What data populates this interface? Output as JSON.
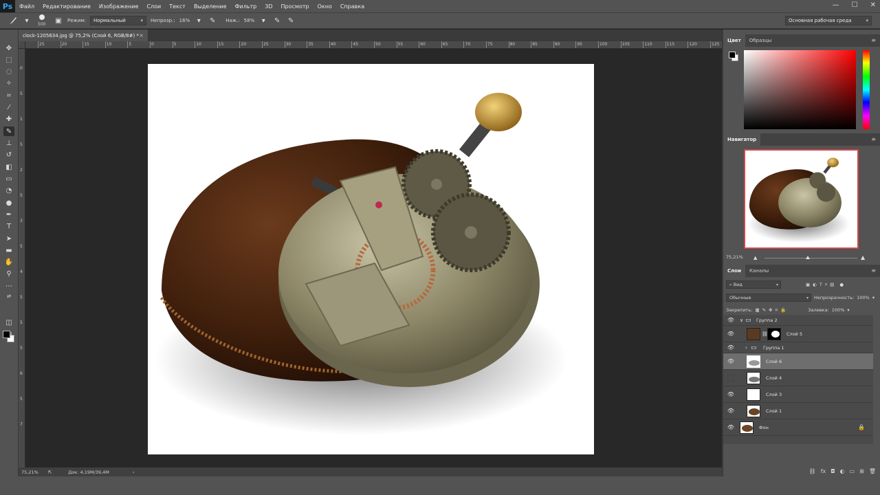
{
  "app": {
    "logo": "Ps"
  },
  "menu": [
    "Файл",
    "Редактирование",
    "Изображение",
    "Слои",
    "Текст",
    "Выделение",
    "Фильтр",
    "3D",
    "Просмотр",
    "Окно",
    "Справка"
  ],
  "window_controls": {
    "minimize": "—",
    "maximize": "☐",
    "close": "✕"
  },
  "options": {
    "brush_size": "500",
    "mode_label": "Режим:",
    "mode_value": "Нормальный",
    "opacity_label": "Непрозр.:",
    "opacity_value": "16%",
    "flow_label": "Наж.:",
    "flow_value": "58%",
    "workspace": "Основная рабочая среда"
  },
  "document": {
    "tab_title": "clock-1205634.jpg @ 75,2% (Слой 6, RGB/8#) *",
    "close": "×"
  },
  "rulers": {
    "top_labels": [
      "25",
      "20",
      "15",
      "10",
      "5",
      "0",
      "5",
      "10",
      "15",
      "20",
      "25",
      "30",
      "35",
      "40",
      "45",
      "50",
      "55",
      "60",
      "65",
      "70",
      "75",
      "80",
      "85",
      "90",
      "95",
      "100",
      "105",
      "110",
      "115",
      "120",
      "125"
    ],
    "left_labels": [
      "0",
      "5",
      "1",
      "5",
      "2",
      "5",
      "3",
      "5",
      "4",
      "5",
      "5",
      "5",
      "6",
      "5",
      "7"
    ]
  },
  "status": {
    "zoom": "75,21%",
    "doc_size": "Док: 4,19M/39,4M"
  },
  "color_panel": {
    "tabs": [
      "Цвет",
      "Образцы"
    ],
    "foreground": "#000000",
    "background": "#ffffff"
  },
  "navigator": {
    "tab": "Навигатор",
    "zoom": "75,21%"
  },
  "layers_panel": {
    "tabs": [
      "Слои",
      "Каналы"
    ],
    "filter": "Вид",
    "blend_mode": "Обычные",
    "opacity_label": "Непрозрачность:",
    "opacity_value": "100%",
    "lock_label": "Закрепить:",
    "fill_label": "Заливка:",
    "fill_value": "100%",
    "layers": [
      {
        "name": "Группа 2",
        "type": "group",
        "visible": true
      },
      {
        "name": "Слой 5",
        "type": "layer-mask",
        "visible": true
      },
      {
        "name": "Группа 1",
        "type": "group",
        "visible": true
      },
      {
        "name": "Слой 6",
        "type": "layer",
        "visible": true,
        "selected": true
      },
      {
        "name": "Слой 4",
        "type": "layer",
        "visible": false
      },
      {
        "name": "Слой 3",
        "type": "layer",
        "visible": true
      },
      {
        "name": "Слой 1",
        "type": "layer",
        "visible": true
      },
      {
        "name": "Фон",
        "type": "background",
        "visible": true
      }
    ]
  }
}
